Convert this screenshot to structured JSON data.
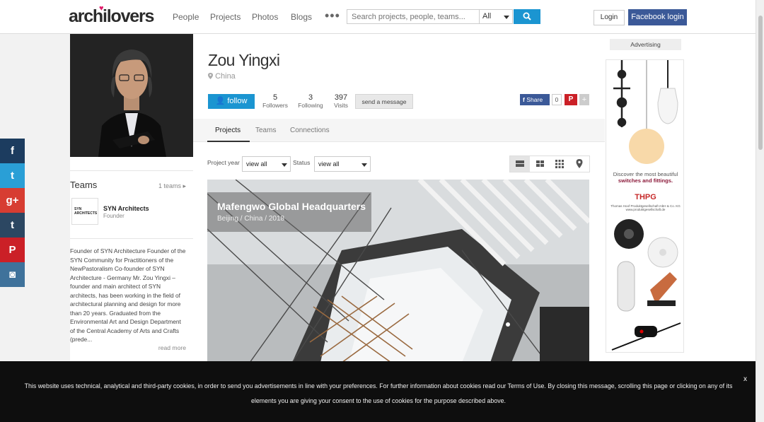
{
  "header": {
    "logo": "archilovers",
    "nav": [
      "People",
      "Projects",
      "Photos",
      "Blogs"
    ],
    "more_label": "•••",
    "search_placeholder": "Search projects, people, teams...",
    "search_scope": "All",
    "login_label": "Login",
    "facebook_login_label": "Facebook login"
  },
  "profile": {
    "name": "Zou Yingxi",
    "location": "China",
    "follow_label": "follow",
    "stats": [
      {
        "value": "5",
        "label": "Followers"
      },
      {
        "value": "3",
        "label": "Following"
      },
      {
        "value": "397",
        "label": "Visits"
      }
    ],
    "message_label": "send a message",
    "share": {
      "label": "Share",
      "count": "0",
      "pinterest": "P",
      "more": "+"
    }
  },
  "tabs": [
    "Projects",
    "Teams",
    "Connections"
  ],
  "filters": {
    "year_label": "Project year",
    "year_value": "view all",
    "status_label": "Status",
    "status_value": "view all"
  },
  "featured_project": {
    "title": "Mafengwo Global Headquarters",
    "subtitle": "Beijing / China / 2018"
  },
  "sidebar": {
    "teams_heading": "Teams",
    "teams_count": "1 teams",
    "team": {
      "name": "SYN Architects",
      "role": "Founder",
      "logo_text": "SYN ARCHITECTS"
    },
    "bio": "Founder of SYN Architecture Founder of the SYN Community for Practitioners of the NewPastoralism Co-founder of SYN Architecture - Germany Mr. Zou Yingxi – founder and main architect of SYN architects, has been working in the field of architectural planning and design for more than 20 years. Graduated from the Environmental Art and Design Department of the Central Academy of Arts and Crafts (prede...",
    "read_more": "read more"
  },
  "social_bar": [
    {
      "icon": "facebook-icon",
      "glyph": "f",
      "color": "#1c3c5f"
    },
    {
      "icon": "twitter-icon",
      "glyph": "t",
      "color": "#2a9fd6"
    },
    {
      "icon": "google-plus-icon",
      "glyph": "g+",
      "color": "#d73d32"
    },
    {
      "icon": "tumblr-icon",
      "glyph": "t",
      "color": "#2c4762"
    },
    {
      "icon": "pinterest-icon",
      "glyph": "P",
      "color": "#cb2027"
    },
    {
      "icon": "instagram-icon",
      "glyph": "◙",
      "color": "#3f729b"
    }
  ],
  "ad": {
    "label": "Advertising",
    "line1": "Discover the most beautiful",
    "line2": "switches and fittings.",
    "brand": "THPG",
    "brand_sub": "Thomas Hoof Produktgesellschaft mbH & Co. KG www.produktgesellschaft.de"
  },
  "cookie": {
    "text": "This website uses technical, analytical and third-party cookies, in order to send you advertisements in line with your preferences. For further information about cookies read our Terms of Use. By closing this message, scrolling this page or clicking on any of its elements you are giving your consent to the use of cookies for the purpose described above.",
    "close": "x"
  }
}
